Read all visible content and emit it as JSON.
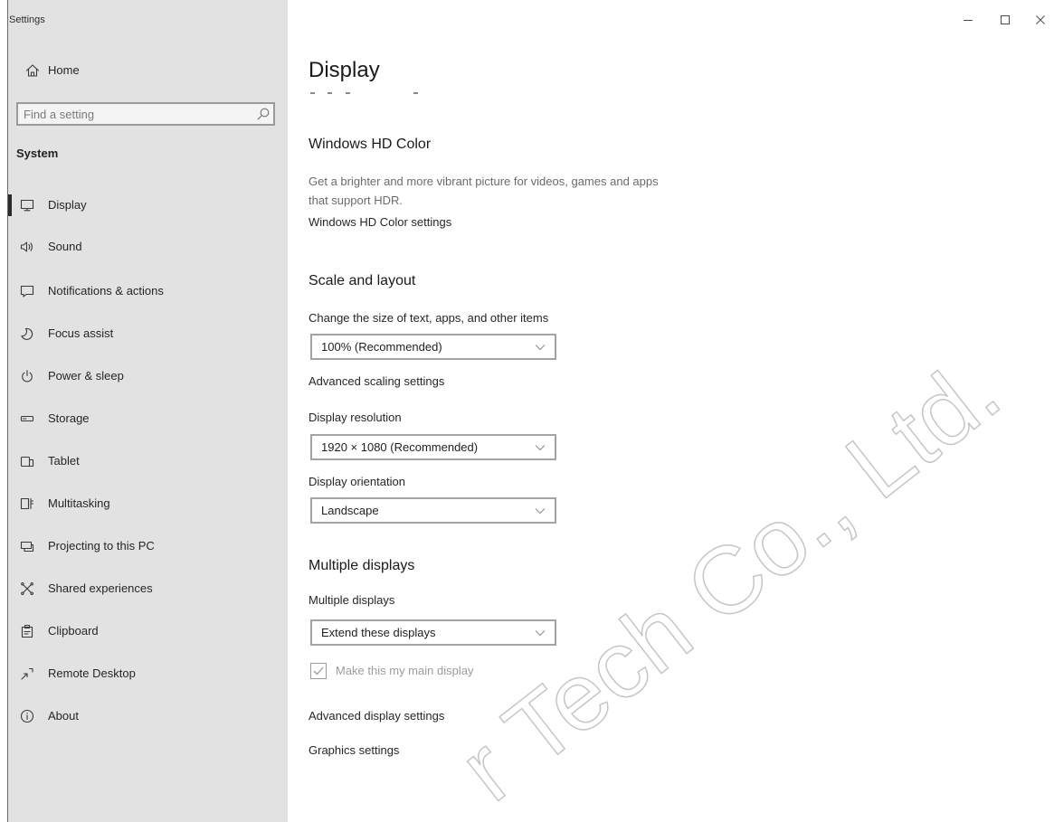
{
  "window": {
    "title": "Settings",
    "controls": {
      "minimize_icon": "minimize-icon",
      "maximize_icon": "maximize-icon",
      "close_icon": "close-icon"
    }
  },
  "sidebar": {
    "home": {
      "label": "Home",
      "icon": "home-icon"
    },
    "search": {
      "placeholder": "Find a setting",
      "value": "",
      "icon": "search-icon"
    },
    "section_title": "System",
    "items": [
      {
        "label": "Display",
        "icon": "display-icon",
        "selected": true
      },
      {
        "label": "Sound",
        "icon": "speaker-icon"
      },
      {
        "label": "Notifications & actions",
        "icon": "notifications-icon"
      },
      {
        "label": "Focus assist",
        "icon": "moon-icon"
      },
      {
        "label": "Power & sleep",
        "icon": "power-icon"
      },
      {
        "label": "Storage",
        "icon": "storage-drive-icon"
      },
      {
        "label": "Tablet",
        "icon": "tablet-icon"
      },
      {
        "label": "Multitasking",
        "icon": "multitasking-icon"
      },
      {
        "label": "Projecting to this PC",
        "icon": "projector-icon"
      },
      {
        "label": "Shared experiences",
        "icon": "shared-experiences-icon"
      },
      {
        "label": "Clipboard",
        "icon": "clipboard-icon"
      },
      {
        "label": "Remote Desktop",
        "icon": "remote-desktop-icon"
      },
      {
        "label": "About",
        "icon": "info-icon"
      }
    ]
  },
  "main": {
    "page_title": "Display",
    "hd_color": {
      "heading": "Windows HD Color",
      "description": [
        "Get a brighter and more vibrant picture for videos, games and apps",
        "that support HDR."
      ],
      "settings_link": "Windows HD Color settings"
    },
    "scale_layout": {
      "heading": "Scale and layout",
      "scale_label": "Change the size of text, apps, and other items",
      "scale_value": "100% (Recommended)",
      "advanced_scaling_link": "Advanced scaling settings",
      "resolution_label": "Display resolution",
      "resolution_value": "1920 × 1080 (Recommended)",
      "orientation_label": "Display orientation",
      "orientation_value": "Landscape"
    },
    "multiple_displays": {
      "heading": "Multiple displays",
      "label": "Multiple displays",
      "value": "Extend these displays",
      "main_display_checkbox": {
        "label": "Make this my main display",
        "checked": true,
        "disabled": true
      }
    },
    "advanced_display_link": "Advanced display settings",
    "graphics_link": "Graphics settings"
  },
  "watermark": "r Tech Co., Ltd.",
  "colors": {
    "sidebar_background": "#e2e2e2",
    "content_background": "#ffffff",
    "text": "#1f1f1f",
    "secondary_text": "#6b6b6b",
    "disabled_text": "#9c9c9c",
    "selection_indicator": "#2b2b2b",
    "control_border": "#a3a3a3",
    "watermark_stroke": "#c6c6c6"
  }
}
